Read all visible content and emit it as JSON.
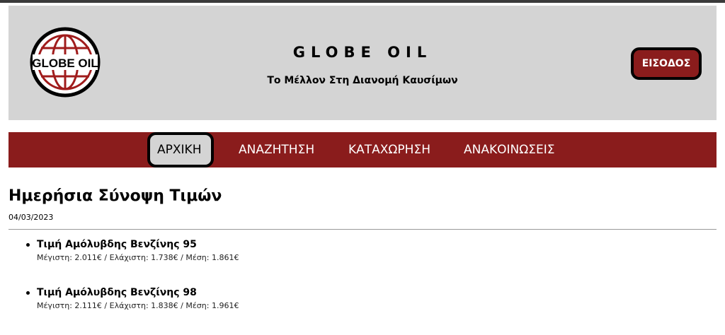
{
  "header": {
    "brand_title": "GLOBE OIL",
    "brand_subtitle": "Το Μέλλον Στη Διανομή Καυσίμων",
    "logo_text": "GLOBE OIL",
    "login_label": "ΕΙΣΟΔΟΣ"
  },
  "nav": {
    "items": [
      {
        "label": "ΑΡΧΙΚΗ",
        "active": true
      },
      {
        "label": "ΑΝΑΖΗΤΗΣΗ",
        "active": false
      },
      {
        "label": "ΚΑΤΑΧΩΡΗΣΗ",
        "active": false
      },
      {
        "label": "ΑΝΑΚΟΙΝΩΣΕΙΣ",
        "active": false
      }
    ]
  },
  "main": {
    "title": "Ημερήσια Σύνοψη Τιμών",
    "date": "04/03/2023",
    "fuels": [
      {
        "name": "Τιμή Αμόλυβδης Βενζίνης 95",
        "stats": "Μέγιστη: 2.011€ / Ελάχιστη: 1.738€ / Μέση: 1.861€"
      },
      {
        "name": "Τιμή Αμόλυβδης Βενζίνης 98",
        "stats": "Μέγιστη: 2.111€ / Ελάχιστη: 1.838€ / Μέση: 1.961€"
      }
    ]
  },
  "colors": {
    "brand_red": "#8a1c1c",
    "header_gray": "#d4d4d4"
  }
}
